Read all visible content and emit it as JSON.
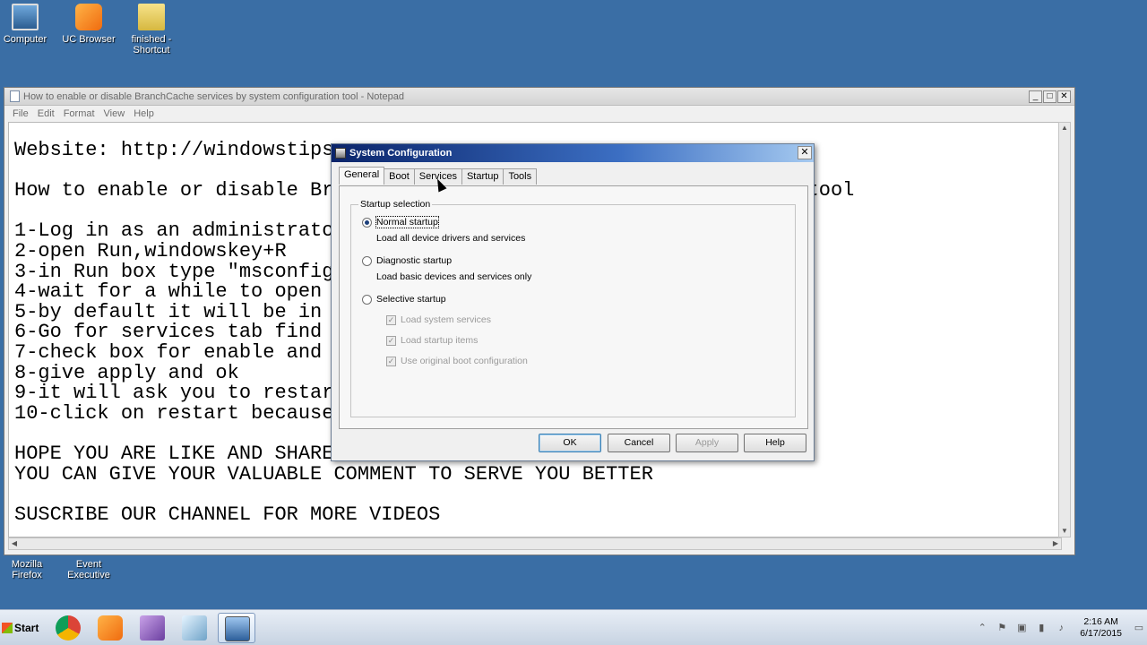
{
  "desktop": {
    "icons": [
      {
        "label": "Computer",
        "icon": "computer-icon"
      },
      {
        "label": "UC Browser",
        "icon": "uc-browser-icon"
      },
      {
        "label": "finished - Shortcut",
        "icon": "folder-shortcut-icon"
      },
      {
        "label": "Mozilla Firefox",
        "icon": "firefox-icon"
      },
      {
        "label": "Event Executive",
        "icon": "event-executive-icon"
      }
    ]
  },
  "notepad": {
    "title": "How to enable or disable BranchCache services by system configuration tool - Notepad",
    "menu": [
      "File",
      "Edit",
      "Format",
      "View",
      "Help"
    ],
    "lines": [
      "Website: http://windowstips",
      "",
      "How to enable or disable Br                                      n tool",
      "",
      "1-Log in as an administrato",
      "2-open Run,windowskey+R",
      "3-in Run box type \"msconfig",
      "4-wait for a while to open ",
      "5-by default it will be in ",
      "6-Go for services tab find ",
      "7-check box for enable and ",
      "8-give apply and ok",
      "9-it will ask you to restar",
      "10-click on restart because",
      "",
      "HOPE YOU ARE LIKE AND SHARE THIS VIDEO",
      "YOU CAN GIVE YOUR VALUABLE COMMENT TO SERVE YOU BETTER",
      "",
      "SUSCRIBE OUR CHANNEL FOR MORE VIDEOS"
    ]
  },
  "dialog": {
    "title": "System Configuration",
    "close": "✕",
    "tabs": [
      "General",
      "Boot",
      "Services",
      "Startup",
      "Tools"
    ],
    "active_tab": "General",
    "group_label": "Startup selection",
    "normal": {
      "label": "Normal startup",
      "desc": "Load all device drivers and services",
      "selected": true
    },
    "diagnostic": {
      "label": "Diagnostic startup",
      "desc": "Load basic devices and services only",
      "selected": false
    },
    "selective": {
      "label": "Selective startup",
      "selected": false
    },
    "checks": [
      {
        "label": "Load system services",
        "checked": true
      },
      {
        "label": "Load startup items",
        "checked": true
      },
      {
        "label": "Use original boot configuration",
        "checked": true
      }
    ],
    "buttons": {
      "ok": "OK",
      "cancel": "Cancel",
      "apply": "Apply",
      "help": "Help"
    }
  },
  "taskbar": {
    "start_label": "Start",
    "apps": [
      "chrome-icon",
      "uc-browser-icon",
      "media-icon",
      "notepad-icon",
      "msconfig-icon"
    ],
    "clock_time": "2:16 AM",
    "clock_date": "6/17/2015"
  }
}
